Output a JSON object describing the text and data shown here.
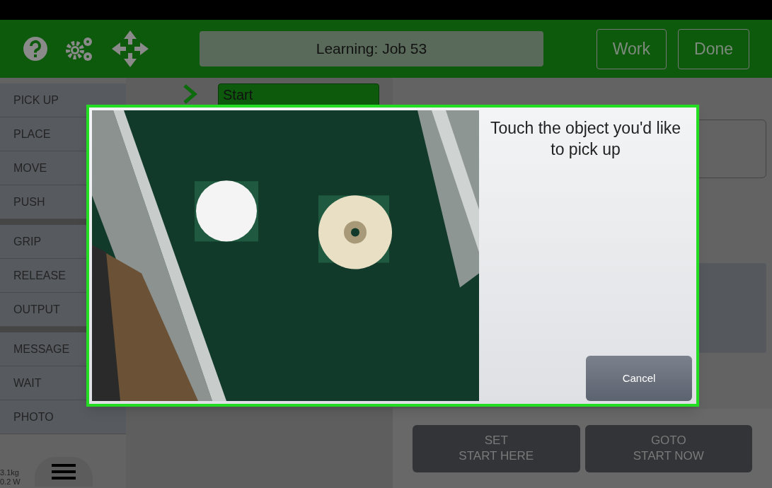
{
  "header": {
    "title": "Learning: Job 53",
    "buttons": [
      "Work",
      "Done"
    ]
  },
  "sidebar": {
    "groups": [
      [
        "PICK UP",
        "PLACE",
        "MOVE",
        "PUSH"
      ],
      [
        "GRIP",
        "RELEASE",
        "OUTPUT"
      ],
      [
        "MESSAGE",
        "WAIT",
        "PHOTO"
      ]
    ]
  },
  "status": {
    "weight": "3.1kg",
    "power": "0.2 W"
  },
  "step": {
    "label": "Start"
  },
  "panel": {
    "buttons": [
      {
        "line1": "SET",
        "line2": "START HERE",
        "disabled": true
      },
      {
        "line1": "GOTO",
        "line2": "START NOW",
        "disabled": true
      }
    ]
  },
  "dialog": {
    "prompt": "Touch the object you'd like to pick up",
    "cancel": "Cancel"
  }
}
